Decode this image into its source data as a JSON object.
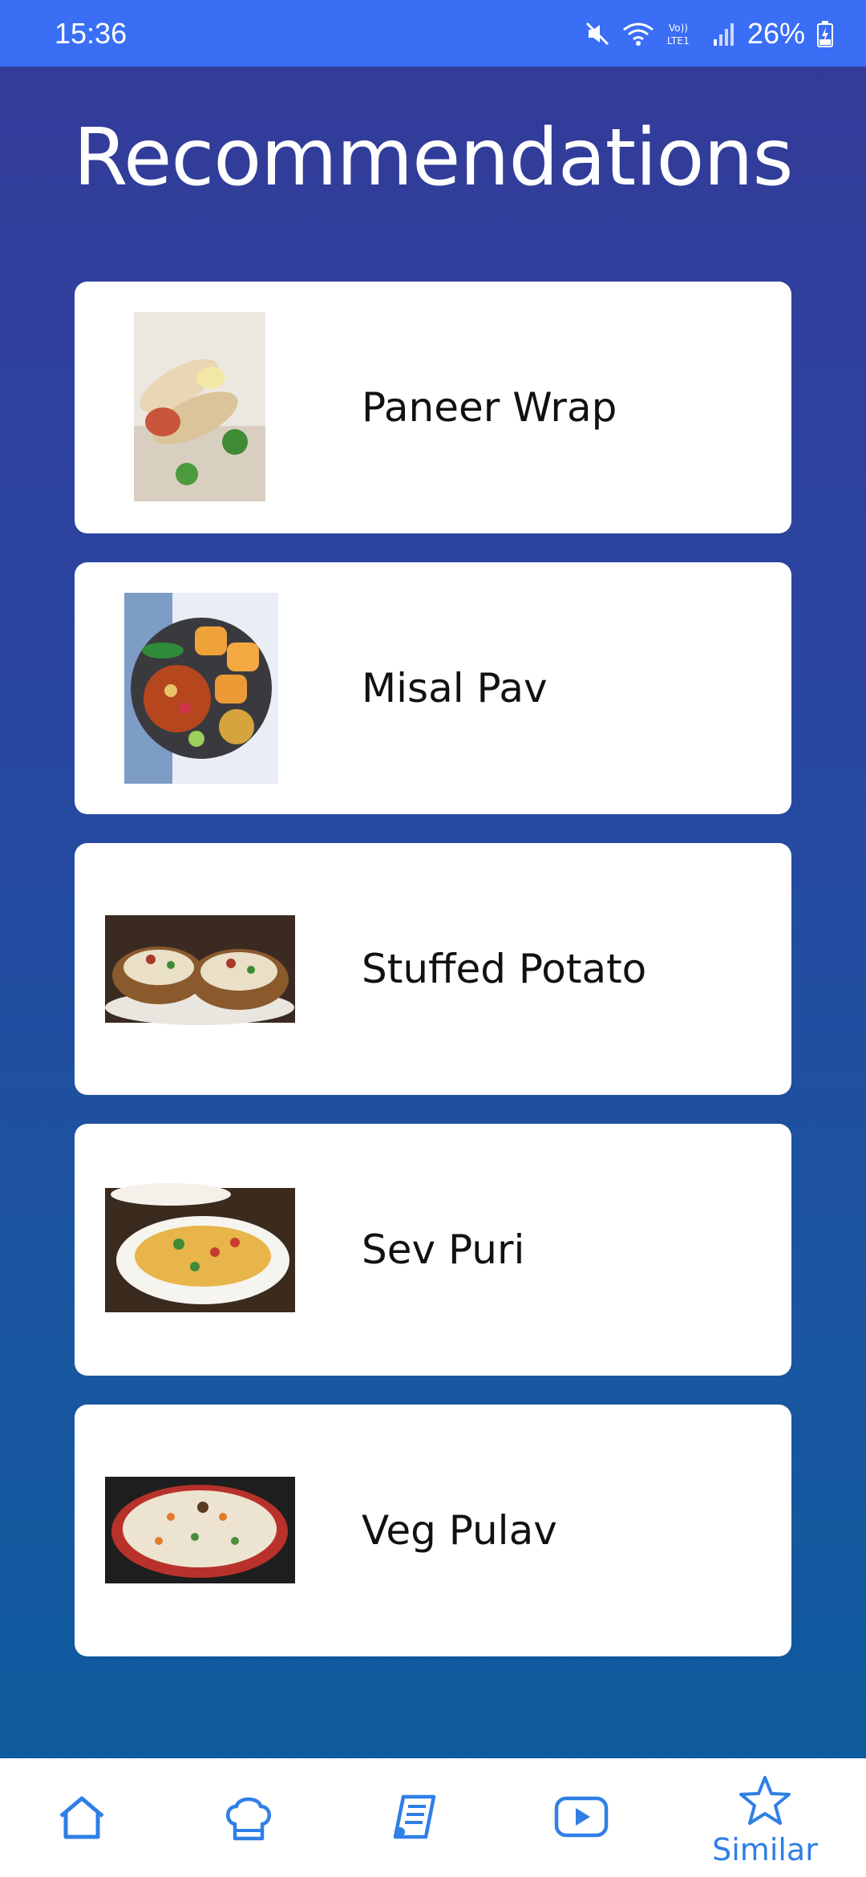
{
  "status_bar": {
    "time": "15:36",
    "battery": "26%",
    "icons": [
      "mute-icon",
      "wifi-icon",
      "volte-icon",
      "signal-icon",
      "battery-icon"
    ]
  },
  "page": {
    "title": "Recommendations"
  },
  "recommendations": [
    {
      "name": "Paneer Wrap",
      "image": "paneer-wrap-photo"
    },
    {
      "name": "Misal Pav",
      "image": "misal-pav-photo"
    },
    {
      "name": "Stuffed Potato",
      "image": "stuffed-potato-photo"
    },
    {
      "name": "Sev Puri",
      "image": "sev-puri-photo"
    },
    {
      "name": "Veg Pulav",
      "image": "veg-pulav-photo"
    }
  ],
  "bottom_nav": {
    "items": [
      {
        "icon": "home-icon"
      },
      {
        "icon": "chef-hat-icon"
      },
      {
        "icon": "recipe-list-icon"
      },
      {
        "icon": "video-play-icon"
      },
      {
        "icon": "star-icon",
        "label": "Similar"
      }
    ]
  },
  "colors": {
    "status_bar": "#3a6ef5",
    "background_top": "#343a98",
    "background_bottom": "#0a5c9c",
    "nav_accent": "#2f7fe6"
  }
}
